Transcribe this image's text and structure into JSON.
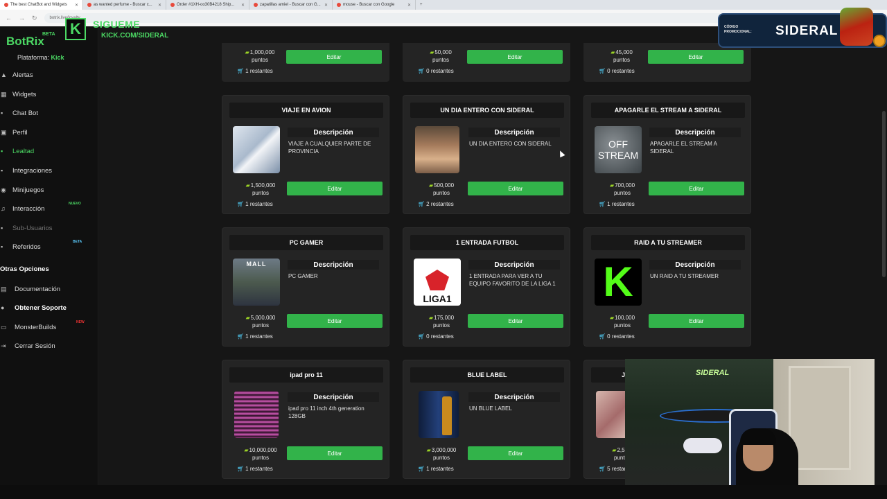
{
  "browser": {
    "tabs": [
      {
        "label": "The best ChatBot and Widgets"
      },
      {
        "label": "as wanted perfume - Buscar c..."
      },
      {
        "label": "Order #1XH-oo30B4218 Ship..."
      },
      {
        "label": "zapatillas amiel - Buscar con G..."
      },
      {
        "label": "mouse - Buscar con Google"
      }
    ],
    "url": "botrix.live/loyalty"
  },
  "overlay": {
    "follow_k": "K",
    "follow_title": "SIGUEME",
    "follow_url": "KICK.COM/SIDERAL",
    "promo_line1": "CÓDIGO",
    "promo_line2": "PROMOCIONAL:",
    "promo_code": "SIDERAL"
  },
  "sidebar": {
    "brand": "BotRix",
    "brand_badge": "BETA",
    "platform_label": "Plataforma:",
    "platform_value": "Kick",
    "items": [
      {
        "label": "Alertas",
        "icon": "warning-icon"
      },
      {
        "label": "Widgets",
        "icon": "grid-icon"
      },
      {
        "label": "Chat Bot",
        "icon": "chat-icon"
      },
      {
        "label": "Perfil",
        "icon": "profile-icon"
      },
      {
        "label": "Lealtad",
        "icon": "loyalty-icon"
      },
      {
        "label": "Integraciones",
        "icon": "user-plus-icon"
      },
      {
        "label": "Minijuegos",
        "icon": "gamepad-icon"
      },
      {
        "label": "Interacción",
        "icon": "music-icon",
        "badge": "NUEVO"
      },
      {
        "label": "Sub-Usuarios",
        "icon": "users-icon"
      },
      {
        "label": "Referidos",
        "icon": "referral-icon",
        "badge": "BETA"
      }
    ],
    "section_title": "Otras Opciones",
    "other_items": [
      {
        "label": "Documentación",
        "icon": "doc-icon"
      },
      {
        "label": "Obtener Soporte",
        "icon": "support-icon"
      },
      {
        "label": "MonsterBuilds",
        "icon": "laptop-icon",
        "badge": "NEW"
      },
      {
        "label": "Cerrar Sesión",
        "icon": "logout-icon"
      }
    ]
  },
  "top_partial": [
    {
      "points": "1,000,000",
      "unit": "puntos",
      "remaining": "1 restantes",
      "button": "Editar"
    },
    {
      "points": "50,000",
      "unit": "puntos",
      "remaining": "0 restantes",
      "button": "Editar"
    },
    {
      "points": "45,000",
      "unit": "puntos",
      "remaining": "0 restantes",
      "button": "Editar"
    }
  ],
  "rewards": [
    {
      "title": "VIAJE EN AVION",
      "desc_heading": "Descripción",
      "desc": "VIAJE A CUALQUIER PARTE DE PROVINCIA",
      "points": "1,500,000",
      "unit": "puntos",
      "remaining": "1 restantes",
      "button": "Editar"
    },
    {
      "title": "UN DIA ENTERO CON SIDERAL",
      "desc_heading": "Descripción",
      "desc": "UN DIA ENTERO CON SIDERAL",
      "points": "500,000",
      "unit": "puntos",
      "remaining": "2 restantes",
      "button": "Editar"
    },
    {
      "title": "APAGARLE EL STREAM A SIDERAL",
      "desc_heading": "Descripción",
      "desc": "APAGARLE EL STREAM A SIDERAL",
      "points": "700,000",
      "unit": "puntos",
      "remaining": "1 restantes",
      "button": "Editar",
      "img_text1": "OFF",
      "img_text2": "STREAM"
    },
    {
      "title": "PC GAMER",
      "desc_heading": "Descripción",
      "desc": "PC GAMER",
      "points": "5,000,000",
      "unit": "puntos",
      "remaining": "1 restantes",
      "button": "Editar",
      "img_text1": "MALL"
    },
    {
      "title": "1 ENTRADA FUTBOL",
      "desc_heading": "Descripción",
      "desc": "1 ENTRADA PARA VER A TU EQUIPO FAVORITO DE LA LIGA 1",
      "points": "175,000",
      "unit": "puntos",
      "remaining": "0 restantes",
      "button": "Editar",
      "img_text1": "LIGA1"
    },
    {
      "title": "RAID A TU STREAMER",
      "desc_heading": "Descripción",
      "desc": "UN RAID A TU STREAMER",
      "points": "100,000",
      "unit": "puntos",
      "remaining": "0 restantes",
      "button": "Editar",
      "img_text1": "K"
    },
    {
      "title": "ipad pro 11",
      "desc_heading": "Descripción",
      "desc": "ipad pro 11 inch 4th generation 128GB",
      "points": "10,000,000",
      "unit": "puntos",
      "remaining": "1 restantes",
      "button": "Editar"
    },
    {
      "title": "BLUE LABEL",
      "desc_heading": "Descripción",
      "desc": "UN BLUE LABEL",
      "points": "3,000,000",
      "unit": "puntos",
      "remaining": "1 restantes",
      "button": "Editar"
    },
    {
      "title": "J",
      "points": "2,500,",
      "unit": "puntos",
      "remaining": "5 restantes"
    }
  ],
  "webcam": {
    "neon_text": "SIDERAL"
  },
  "colors": {
    "accent": "#32b34a",
    "brand": "#4cd964",
    "cart": "#4fc8f0",
    "coin": "#9bd326"
  }
}
